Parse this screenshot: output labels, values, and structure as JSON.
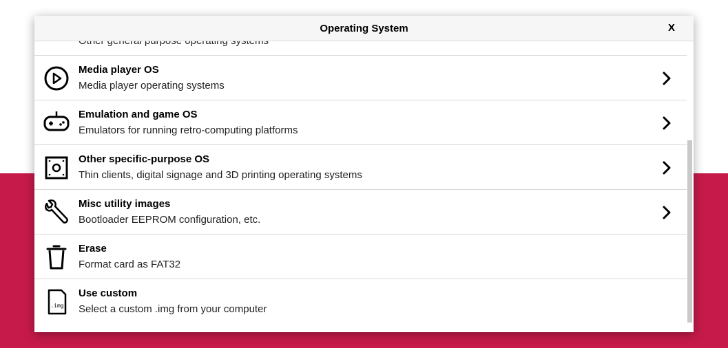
{
  "dialog": {
    "title": "Operating System",
    "close_label": "X"
  },
  "items": [
    {
      "title": "",
      "desc": "Other general purpose operating systems",
      "icon": "general-os-icon",
      "chevron": true
    },
    {
      "title": "Media player OS",
      "desc": "Media player operating systems",
      "icon": "play-circle-icon",
      "chevron": true
    },
    {
      "title": "Emulation and game OS",
      "desc": "Emulators for running retro-computing platforms",
      "icon": "gamepad-icon",
      "chevron": true
    },
    {
      "title": "Other specific-purpose OS",
      "desc": "Thin clients, digital signage and 3D printing operating systems",
      "icon": "specific-purpose-icon",
      "chevron": true
    },
    {
      "title": "Misc utility images",
      "desc": "Bootloader EEPROM configuration, etc.",
      "icon": "wrench-icon",
      "chevron": true
    },
    {
      "title": "Erase",
      "desc": "Format card as FAT32",
      "icon": "trash-icon",
      "chevron": false
    },
    {
      "title": "Use custom",
      "desc": "Select a custom .img from your computer",
      "icon": "sd-card-icon",
      "icon_text": ".img",
      "chevron": false
    }
  ],
  "colors": {
    "background_accent": "#c51a4a",
    "header_bg": "#f6f6f6",
    "divider": "#d9d9d9"
  }
}
